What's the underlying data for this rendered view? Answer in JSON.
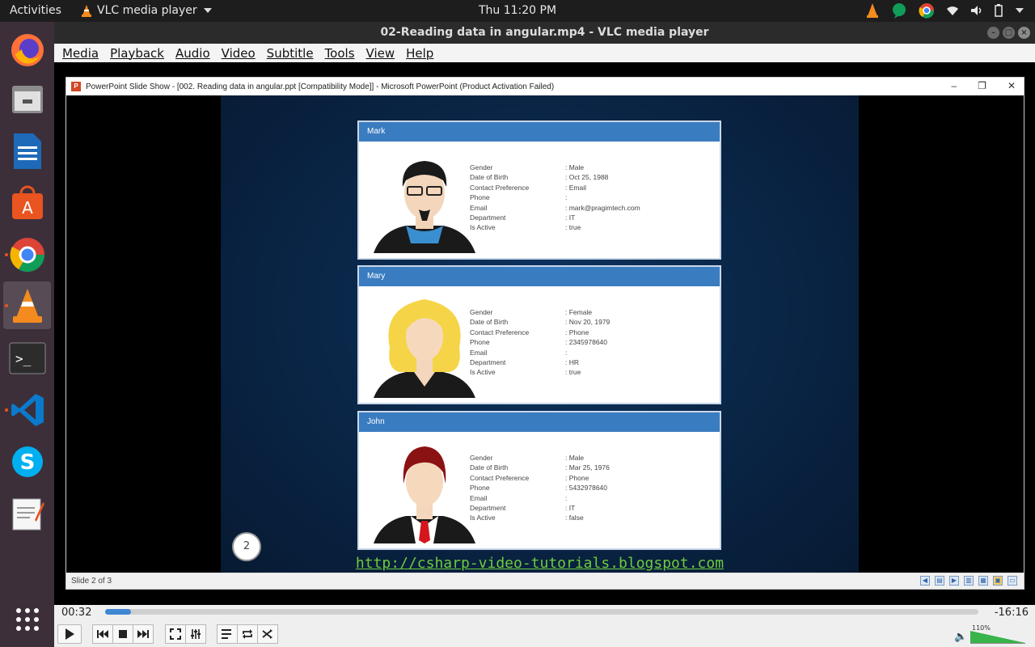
{
  "topbar": {
    "activities": "Activities",
    "app_name": "VLC media player",
    "clock": "Thu 11:20 PM"
  },
  "dock": [
    "Firefox",
    "Files",
    "LibreOffice Writer",
    "Ubuntu Software",
    "Google Chrome",
    "VLC media player",
    "Terminal",
    "Visual Studio Code",
    "Skype",
    "Text Editor",
    "Show Applications"
  ],
  "vlc": {
    "title": "02-Reading data in angular.mp4 - VLC media player",
    "menu": [
      "Media",
      "Playback",
      "Audio",
      "Video",
      "Subtitle",
      "Tools",
      "View",
      "Help"
    ],
    "time_elapsed": "00:32",
    "time_remaining": "-16:16",
    "progress": 0.03,
    "volume": "110%",
    "accent": "#3d87d3"
  },
  "ppt": {
    "title": "PowerPoint Slide Show - [002. Reading data in angular.ppt [Compatibility Mode]] - Microsoft PowerPoint (Product Activation Failed)",
    "status": "Slide 2 of 3",
    "slide_number": "2",
    "url": "http://csharp-video-tutorials.blogspot.com",
    "field_labels": [
      "Gender",
      "Date of Birth",
      "Contact Preference",
      "Phone",
      "Email",
      "Department",
      "Is Active"
    ],
    "cards": [
      {
        "name": "Mark",
        "values": [
          ": Male",
          ": Oct 25, 1988",
          ": Email",
          ":",
          ": mark@pragimtech.com",
          ": IT",
          ": true"
        ]
      },
      {
        "name": "Mary",
        "values": [
          ": Female",
          ": Nov 20, 1979",
          ": Phone",
          ": 2345978640",
          ":",
          ": HR",
          ": true"
        ]
      },
      {
        "name": "John",
        "values": [
          ": Male",
          ": Mar 25, 1976",
          ": Phone",
          ": 5432978640",
          ":",
          ": IT",
          ": false"
        ]
      }
    ]
  }
}
